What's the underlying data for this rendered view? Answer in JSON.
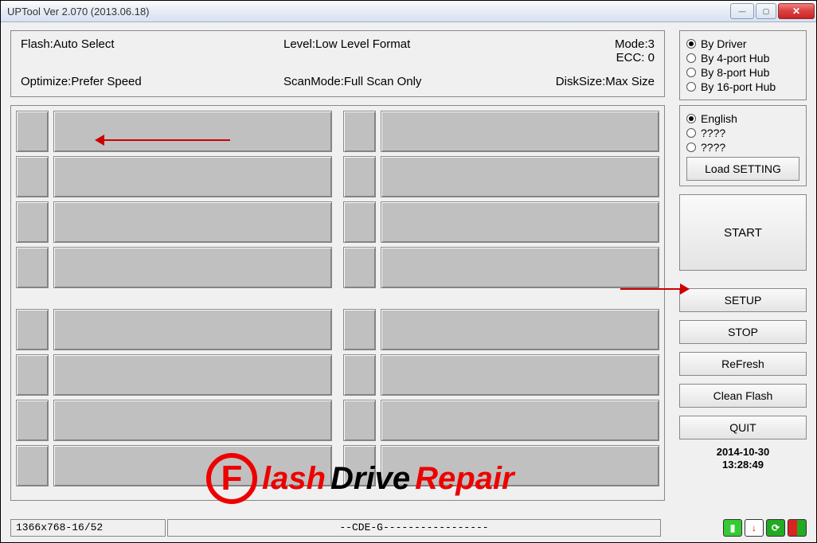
{
  "window": {
    "title": "UPTool Ver 2.070 (2013.06.18)"
  },
  "info": {
    "flash": "Flash:Auto Select",
    "level": "Level:Low Level Format",
    "mode": "Mode:3",
    "ecc": "ECC: 0",
    "optimize": "Optimize:Prefer Speed",
    "scanmode": "ScanMode:Full Scan Only",
    "disksize": "DiskSize:Max Size"
  },
  "radios_port": {
    "selected": 0,
    "options": [
      "By Driver",
      "By 4-port Hub",
      "By 8-port Hub",
      "By 16-port Hub"
    ]
  },
  "radios_lang": {
    "selected": 0,
    "options": [
      "English",
      "????",
      "????"
    ]
  },
  "buttons": {
    "load": "Load SETTING",
    "start": "START",
    "setup": "SETUP",
    "stop": "STOP",
    "refresh": "ReFresh",
    "clean": "Clean Flash",
    "quit": "QUIT"
  },
  "timestamp": {
    "date": "2014-10-30",
    "time": "13:28:49"
  },
  "status": {
    "left": "1366x768-16/52",
    "mid": "--CDE-G-----------------"
  },
  "watermark": {
    "f": "F",
    "lash": "lash",
    "drive": "Drive",
    "repair": "Repair"
  }
}
